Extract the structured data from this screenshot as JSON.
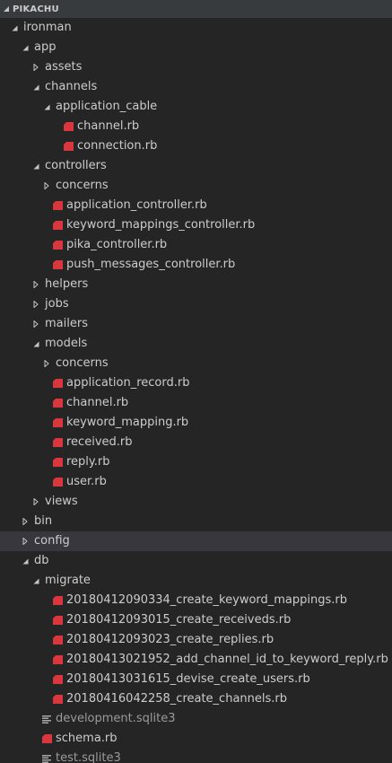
{
  "panel": {
    "title": "PIKACHU"
  },
  "colors": {
    "background": "#252526",
    "header_background": "#383b3d",
    "selected_row": "#37373d",
    "text": "#cccccc",
    "ruby_icon": "#d9363e",
    "twisty": "#c5c5c5"
  },
  "tree": [
    {
      "name": "ironman",
      "type": "folder",
      "expanded": true,
      "depth": 0
    },
    {
      "name": "app",
      "type": "folder",
      "expanded": true,
      "depth": 1
    },
    {
      "name": "assets",
      "type": "folder",
      "expanded": false,
      "depth": 2
    },
    {
      "name": "channels",
      "type": "folder",
      "expanded": true,
      "depth": 2
    },
    {
      "name": "application_cable",
      "type": "folder",
      "expanded": true,
      "depth": 3
    },
    {
      "name": "channel.rb",
      "type": "ruby",
      "depth": 4
    },
    {
      "name": "connection.rb",
      "type": "ruby",
      "depth": 4
    },
    {
      "name": "controllers",
      "type": "folder",
      "expanded": true,
      "depth": 2
    },
    {
      "name": "concerns",
      "type": "folder",
      "expanded": false,
      "depth": 3
    },
    {
      "name": "application_controller.rb",
      "type": "ruby",
      "depth": 3
    },
    {
      "name": "keyword_mappings_controller.rb",
      "type": "ruby",
      "depth": 3
    },
    {
      "name": "pika_controller.rb",
      "type": "ruby",
      "depth": 3
    },
    {
      "name": "push_messages_controller.rb",
      "type": "ruby",
      "depth": 3
    },
    {
      "name": "helpers",
      "type": "folder",
      "expanded": false,
      "depth": 2
    },
    {
      "name": "jobs",
      "type": "folder",
      "expanded": false,
      "depth": 2
    },
    {
      "name": "mailers",
      "type": "folder",
      "expanded": false,
      "depth": 2
    },
    {
      "name": "models",
      "type": "folder",
      "expanded": true,
      "depth": 2
    },
    {
      "name": "concerns",
      "type": "folder",
      "expanded": false,
      "depth": 3
    },
    {
      "name": "application_record.rb",
      "type": "ruby",
      "depth": 3
    },
    {
      "name": "channel.rb",
      "type": "ruby",
      "depth": 3
    },
    {
      "name": "keyword_mapping.rb",
      "type": "ruby",
      "depth": 3
    },
    {
      "name": "received.rb",
      "type": "ruby",
      "depth": 3
    },
    {
      "name": "reply.rb",
      "type": "ruby",
      "depth": 3
    },
    {
      "name": "user.rb",
      "type": "ruby",
      "depth": 3
    },
    {
      "name": "views",
      "type": "folder",
      "expanded": false,
      "depth": 2
    },
    {
      "name": "bin",
      "type": "folder",
      "expanded": false,
      "depth": 1
    },
    {
      "name": "config",
      "type": "folder",
      "expanded": false,
      "depth": 1,
      "selected": true
    },
    {
      "name": "db",
      "type": "folder",
      "expanded": true,
      "depth": 1
    },
    {
      "name": "migrate",
      "type": "folder",
      "expanded": true,
      "depth": 2
    },
    {
      "name": "20180412090334_create_keyword_mappings.rb",
      "type": "ruby",
      "depth": 3
    },
    {
      "name": "20180412093015_create_receiveds.rb",
      "type": "ruby",
      "depth": 3
    },
    {
      "name": "20180412093023_create_replies.rb",
      "type": "ruby",
      "depth": 3
    },
    {
      "name": "20180413021952_add_channel_id_to_keyword_reply.rb",
      "type": "ruby",
      "depth": 3
    },
    {
      "name": "20180413031615_devise_create_users.rb",
      "type": "ruby",
      "depth": 3
    },
    {
      "name": "20180416042258_create_channels.rb",
      "type": "ruby",
      "depth": 3
    },
    {
      "name": "development.sqlite3",
      "type": "text",
      "depth": 2,
      "dim": true
    },
    {
      "name": "schema.rb",
      "type": "ruby",
      "depth": 2
    },
    {
      "name": "test.sqlite3",
      "type": "text",
      "depth": 2,
      "dim": true
    }
  ]
}
